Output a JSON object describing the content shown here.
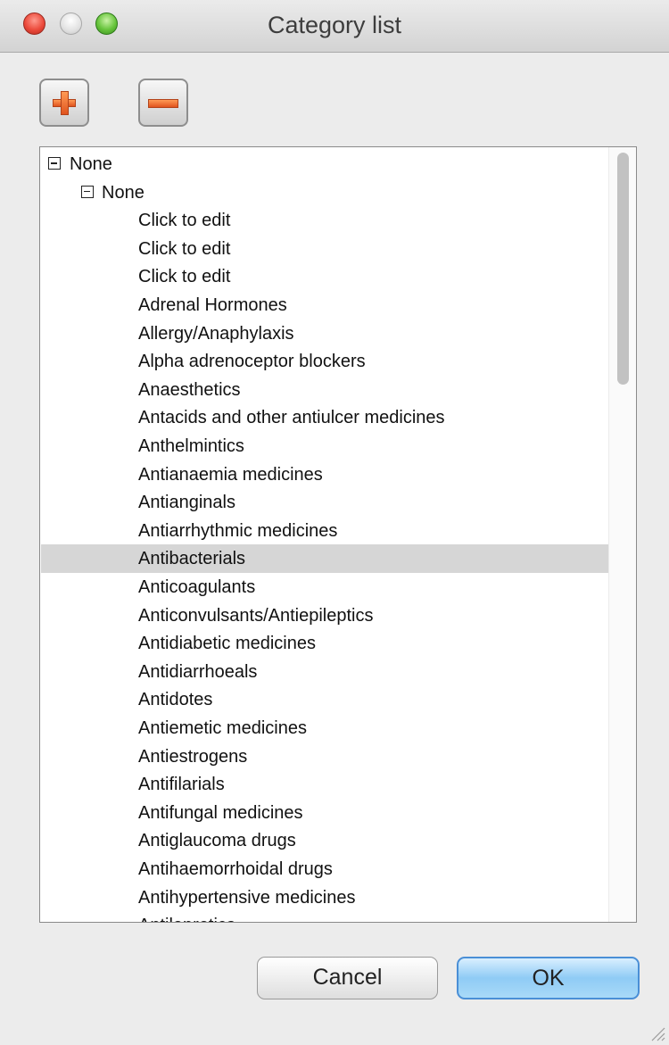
{
  "window": {
    "title": "Category list"
  },
  "toolbar": {
    "add_icon": "plus-icon",
    "remove_icon": "minus-icon"
  },
  "tree": {
    "root": {
      "label": "None",
      "expanded": true
    },
    "child": {
      "label": "None",
      "expanded": true
    },
    "items": [
      "Click to edit",
      "Click to edit",
      "Click to edit",
      "Adrenal Hormones",
      "Allergy/Anaphylaxis",
      "Alpha adrenoceptor blockers",
      "Anaesthetics",
      "Antacids and other antiulcer medicines",
      "Anthelmintics",
      "Antianaemia medicines",
      "Antianginals",
      "Antiarrhythmic medicines",
      "Antibacterials",
      "Anticoagulants",
      "Anticonvulsants/Antiepileptics",
      "Antidiabetic medicines",
      "Antidiarrhoeals",
      "Antidotes",
      "Antiemetic medicines",
      "Antiestrogens",
      "Antifilarials",
      "Antifungal medicines",
      "Antiglaucoma drugs",
      "Antihaemorrhoidal drugs",
      "Antihypertensive medicines",
      "Antileprotics"
    ],
    "selected_item": "Antibacterials"
  },
  "buttons": {
    "cancel": "Cancel",
    "ok": "OK"
  },
  "colors": {
    "selection": "#d6d6d6",
    "ok_button": "#8fcbf5",
    "accent": "#e0541e"
  }
}
